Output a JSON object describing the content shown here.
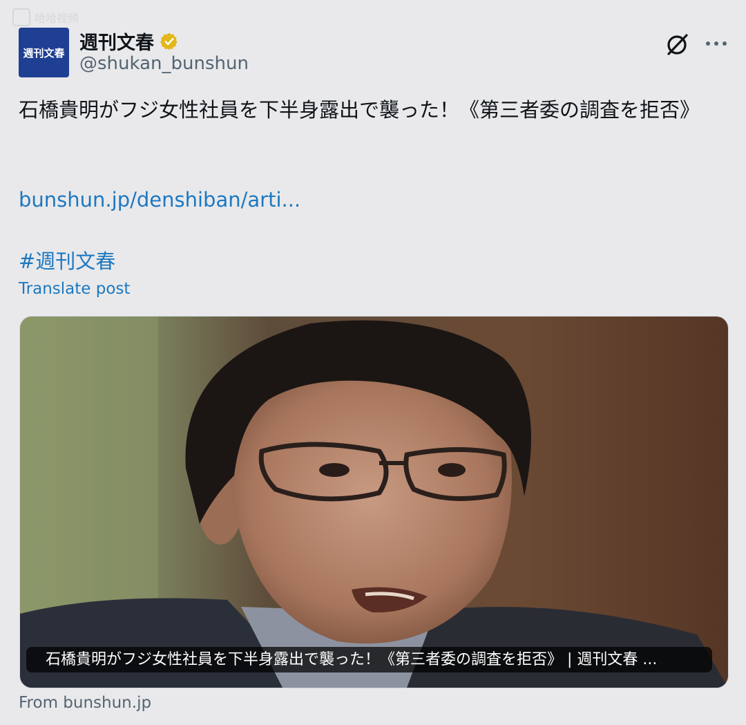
{
  "watermark": {
    "label": "哈哈视频"
  },
  "author": {
    "avatar_text": "週刊文春",
    "display_name": "週刊文春",
    "handle": "@shukan_bunshun",
    "verified_icon": "verified-gold-badge-icon"
  },
  "actions": {
    "grok_icon": "grok-icon",
    "more_icon": "more-icon"
  },
  "post": {
    "text": "石橋貴明がフジ女性社員を下半身露出で襲った！《第三者委の調査を拒否》",
    "link": "bunshun.jp/denshiban/arti...",
    "hashtag": "#週刊文春",
    "translate_label": "Translate post"
  },
  "card": {
    "caption": "石橋貴明がフジ女性社員を下半身露出で襲った！《第三者委の調査を拒否》 | 週刊文春 ...",
    "from_label": "From bunshun.jp"
  },
  "colors": {
    "link": "#1d78c0",
    "avatar_bg": "#1f3f93",
    "background": "#e9e9eb",
    "verified": "#e2b719"
  }
}
